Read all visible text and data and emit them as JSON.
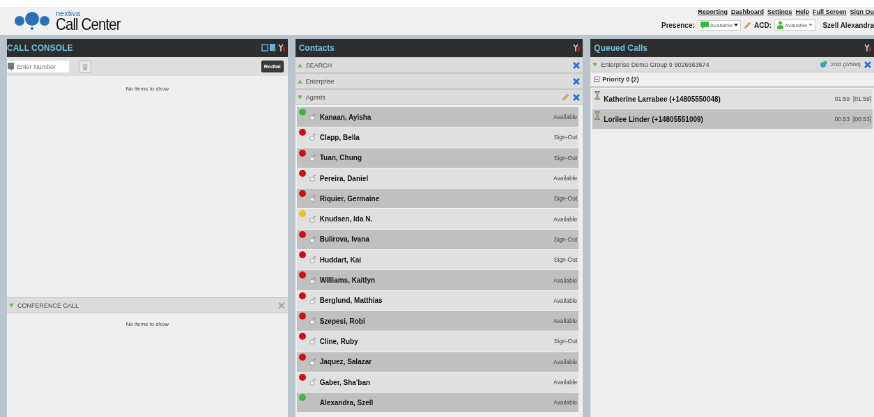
{
  "logo": {
    "brand": "nextiva",
    "product": "Call Center"
  },
  "top_links": [
    "Reporting",
    "Dashboard",
    "Settings",
    "Help",
    "Full Screen",
    "Sign Ou"
  ],
  "presence": {
    "label": "Presence:",
    "value": "Available"
  },
  "acd": {
    "label": "ACD:",
    "value": "Available"
  },
  "user_name": "Szell Alexandra",
  "call_console": {
    "title": "CALL CONSOLE",
    "number_placeholder": "Enter Number",
    "redial": "Redial",
    "empty": "No items to show"
  },
  "conference_call": {
    "title": "CONFERENCE CALL",
    "empty": "No items to show"
  },
  "contacts": {
    "title": "Contacts",
    "sections": [
      {
        "title": "SEARCH",
        "expanded": false,
        "editable": false
      },
      {
        "title": "Enterprise",
        "expanded": false,
        "editable": false
      },
      {
        "title": "Agents",
        "expanded": true,
        "editable": true
      }
    ],
    "agents": [
      {
        "name": "Kanaan, Ayisha",
        "status": "Available",
        "color": "#3cb83c",
        "phone": true
      },
      {
        "name": "Clapp, Bella",
        "status": "Sign-Out",
        "color": "#d01010",
        "phone": true
      },
      {
        "name": "Tuan, Chung",
        "status": "Sign-Out",
        "color": "#d01010",
        "phone": true
      },
      {
        "name": "Pereira, Daniel",
        "status": "Available",
        "color": "#d01010",
        "phone": true
      },
      {
        "name": "Riquier, Germaine",
        "status": "Sign-Out",
        "color": "#d01010",
        "phone": true
      },
      {
        "name": "Knudsen, Ida N.",
        "status": "Available",
        "color": "#f0c020",
        "phone": true
      },
      {
        "name": "Bulirova, Ivana",
        "status": "Sign-Out",
        "color": "#d01010",
        "phone": true
      },
      {
        "name": "Huddart, Kai",
        "status": "Sign-Out",
        "color": "#d01010",
        "phone": true
      },
      {
        "name": "Williams, Kaitlyn",
        "status": "Available",
        "color": "#d01010",
        "phone": true
      },
      {
        "name": "Berglund, Matthias",
        "status": "Available",
        "color": "#d01010",
        "phone": true
      },
      {
        "name": "Szepesi, Robi",
        "status": "Available",
        "color": "#d01010",
        "phone": true
      },
      {
        "name": "Cline, Ruby",
        "status": "Sign-Out",
        "color": "#d01010",
        "phone": true
      },
      {
        "name": "Jaquez, Salazar",
        "status": "Available",
        "color": "#d01010",
        "phone": true
      },
      {
        "name": "Gaber, Sha'ban",
        "status": "Available",
        "color": "#d01010",
        "phone": true
      },
      {
        "name": "Alexandra, Szell",
        "status": "Available",
        "color": "#3cb83c",
        "phone": false
      }
    ]
  },
  "queued_calls": {
    "title": "Queued Calls",
    "group": {
      "name": "Enterprise Demo Group 9 6026663674",
      "expanded": true,
      "count": "2/10 (2/500)"
    },
    "priority": {
      "label": "Priority 0 (2)",
      "expanded": true
    },
    "calls": [
      {
        "caller": "Katherine Larrabee (+14805550048)",
        "wait": "01:59",
        "total": "[01:59]"
      },
      {
        "caller": "Lorilee Linder (+14805551009)",
        "wait": "00:53",
        "total": "[00:53]"
      }
    ]
  }
}
